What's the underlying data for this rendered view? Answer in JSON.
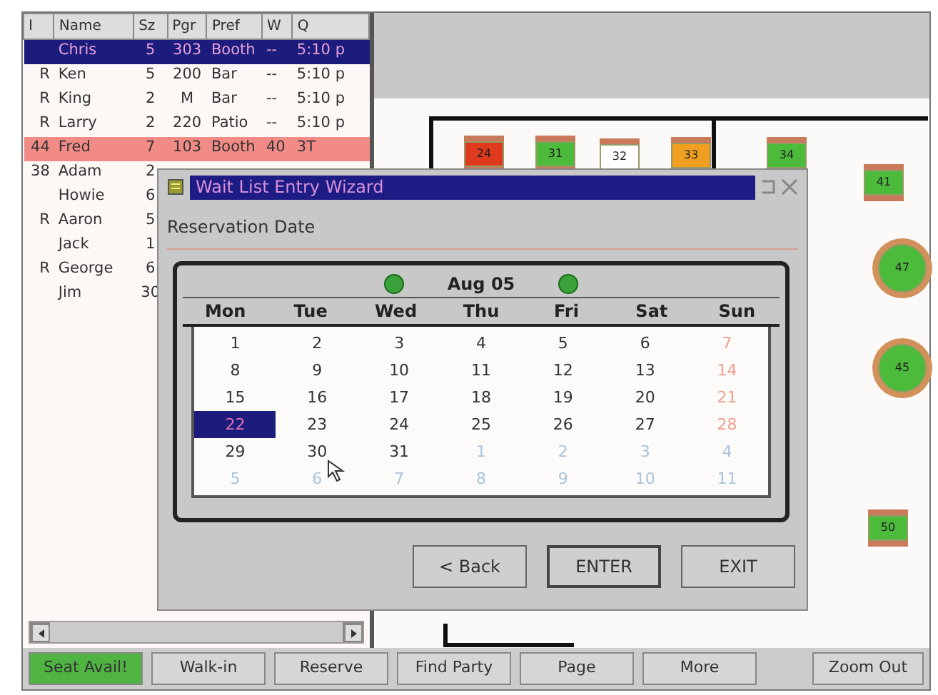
{
  "waitlist": {
    "columns": [
      "I",
      "Name",
      "Sz",
      "Pgr",
      "Pref",
      "W",
      "Q"
    ],
    "rows": [
      {
        "cells": [
          "",
          "Chris",
          "5",
          "303",
          "Booth",
          "--",
          "5:10 p"
        ],
        "selected": true,
        "highlighted": false
      },
      {
        "cells": [
          "R",
          "Ken",
          "5",
          "200",
          "Bar",
          "--",
          "5:10 p"
        ],
        "selected": false,
        "highlighted": false
      },
      {
        "cells": [
          "R",
          "King",
          "2",
          "M",
          "Bar",
          "--",
          "5:10 p"
        ],
        "selected": false,
        "highlighted": false
      },
      {
        "cells": [
          "R",
          "Larry",
          "2",
          "220",
          "Patio",
          "--",
          "5:10 p"
        ],
        "selected": false,
        "highlighted": false
      },
      {
        "cells": [
          "44",
          "Fred",
          "7",
          "103",
          "Booth",
          "40",
          "3T"
        ],
        "selected": false,
        "highlighted": true
      },
      {
        "cells": [
          "38",
          "Adam",
          "2"
        ],
        "selected": false,
        "highlighted": false
      },
      {
        "cells": [
          "",
          "Howie",
          "6"
        ],
        "selected": false,
        "highlighted": false
      },
      {
        "cells": [
          "R",
          "Aaron",
          "5"
        ],
        "selected": false,
        "highlighted": false
      },
      {
        "cells": [
          "",
          "Jack",
          "1"
        ],
        "selected": false,
        "highlighted": false
      },
      {
        "cells": [
          "R",
          "George",
          "6"
        ],
        "selected": false,
        "highlighted": false
      },
      {
        "cells": [
          "",
          "Jim",
          "30"
        ],
        "selected": false,
        "highlighted": false
      }
    ]
  },
  "floor_plan": {
    "tables": [
      {
        "number": "24",
        "kind": "square",
        "color": "#e03a1e"
      },
      {
        "number": "31",
        "kind": "square",
        "color": "#4cbb3c"
      },
      {
        "number": "32",
        "kind": "square",
        "color": "#ffffff"
      },
      {
        "number": "33",
        "kind": "square",
        "color": "#f0a020"
      },
      {
        "number": "34",
        "kind": "square",
        "color": "#4cbb3c"
      },
      {
        "number": "41",
        "kind": "square",
        "color": "#4cbb3c"
      },
      {
        "number": "47",
        "kind": "round",
        "color": "#4cbb3c"
      },
      {
        "number": "45",
        "kind": "round",
        "color": "#4cbb3c"
      },
      {
        "number": "50",
        "kind": "square",
        "color": "#4cbb3c"
      }
    ]
  },
  "dialog": {
    "title": "Wait List Entry Wizard",
    "label": "Reservation Date",
    "calendar": {
      "month": "Aug 05",
      "weekdays": [
        "Mon",
        "Tue",
        "Wed",
        "Thu",
        "Fri",
        "Sat",
        "Sun"
      ],
      "weeks": [
        [
          {
            "day": "1",
            "kind": "day",
            "selected": false
          },
          {
            "day": "2",
            "kind": "day",
            "selected": false
          },
          {
            "day": "3",
            "kind": "day",
            "selected": false
          },
          {
            "day": "4",
            "kind": "day",
            "selected": false
          },
          {
            "day": "5",
            "kind": "day",
            "selected": false
          },
          {
            "day": "6",
            "kind": "day",
            "selected": false
          },
          {
            "day": "7",
            "kind": "weekend",
            "selected": false
          }
        ],
        [
          {
            "day": "8",
            "kind": "day",
            "selected": false
          },
          {
            "day": "9",
            "kind": "day",
            "selected": false
          },
          {
            "day": "10",
            "kind": "day",
            "selected": false
          },
          {
            "day": "11",
            "kind": "day",
            "selected": false
          },
          {
            "day": "12",
            "kind": "day",
            "selected": false
          },
          {
            "day": "13",
            "kind": "day",
            "selected": false
          },
          {
            "day": "14",
            "kind": "weekend",
            "selected": false
          }
        ],
        [
          {
            "day": "15",
            "kind": "day",
            "selected": false
          },
          {
            "day": "16",
            "kind": "day",
            "selected": false
          },
          {
            "day": "17",
            "kind": "day",
            "selected": false
          },
          {
            "day": "18",
            "kind": "day",
            "selected": false
          },
          {
            "day": "19",
            "kind": "day",
            "selected": false
          },
          {
            "day": "20",
            "kind": "day",
            "selected": false
          },
          {
            "day": "21",
            "kind": "weekend",
            "selected": false
          }
        ],
        [
          {
            "day": "22",
            "kind": "day",
            "selected": true
          },
          {
            "day": "23",
            "kind": "day",
            "selected": false
          },
          {
            "day": "24",
            "kind": "day",
            "selected": false
          },
          {
            "day": "25",
            "kind": "day",
            "selected": false
          },
          {
            "day": "26",
            "kind": "day",
            "selected": false
          },
          {
            "day": "27",
            "kind": "day",
            "selected": false
          },
          {
            "day": "28",
            "kind": "weekend",
            "selected": false
          }
        ],
        [
          {
            "day": "29",
            "kind": "day",
            "selected": false
          },
          {
            "day": "30",
            "kind": "day",
            "selected": false
          },
          {
            "day": "31",
            "kind": "day",
            "selected": false
          },
          {
            "day": "1",
            "kind": "other",
            "selected": false
          },
          {
            "day": "2",
            "kind": "other",
            "selected": false
          },
          {
            "day": "3",
            "kind": "other",
            "selected": false
          },
          {
            "day": "4",
            "kind": "other",
            "selected": false
          }
        ],
        [
          {
            "day": "5",
            "kind": "other",
            "selected": false
          },
          {
            "day": "6",
            "kind": "other",
            "selected": false
          },
          {
            "day": "7",
            "kind": "other",
            "selected": false
          },
          {
            "day": "8",
            "kind": "other",
            "selected": false
          },
          {
            "day": "9",
            "kind": "other",
            "selected": false
          },
          {
            "day": "10",
            "kind": "other",
            "selected": false
          },
          {
            "day": "11",
            "kind": "other",
            "selected": false
          }
        ]
      ]
    },
    "buttons": [
      "< Back",
      "ENTER",
      "EXIT"
    ]
  },
  "toolbar": [
    {
      "label": "Seat Avail!",
      "selected": true
    },
    {
      "label": "Walk-in",
      "selected": false
    },
    {
      "label": "Reserve",
      "selected": false
    },
    {
      "label": "Find Party",
      "selected": false
    },
    {
      "label": "Page",
      "selected": false
    },
    {
      "label": "More",
      "selected": false
    },
    {
      "label": "Zoom Out",
      "selected": false
    }
  ]
}
